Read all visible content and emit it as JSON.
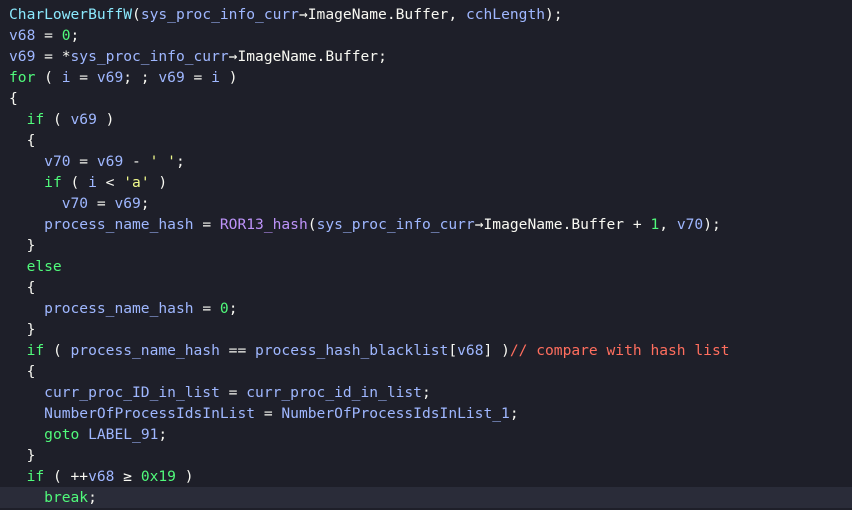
{
  "colors": {
    "background": "#1e1f29",
    "current_line": "#2a2c39",
    "identifier": "#8be9fd",
    "keyword": "#50fa7b",
    "number": "#50fa7b",
    "string": "#f1fa8c",
    "function_call": "#bd93f9",
    "comment": "#ff6e5e",
    "default_text": "#f8f8f2"
  },
  "code": {
    "highlighted_line": 23,
    "lines": [
      [
        [
          "fn",
          "CharLowerBuffW"
        ],
        [
          "pun",
          "("
        ],
        [
          "var",
          "sys_proc_info_curr"
        ],
        [
          "op",
          "→"
        ],
        [
          "fld",
          "ImageName.Buffer"
        ],
        [
          "pun",
          ", "
        ],
        [
          "var",
          "cchLength"
        ],
        [
          "pun",
          ");"
        ]
      ],
      [
        [
          "var",
          "v68"
        ],
        [
          "op",
          " = "
        ],
        [
          "num",
          "0"
        ],
        [
          "pun",
          ";"
        ]
      ],
      [
        [
          "var",
          "v69"
        ],
        [
          "op",
          " = "
        ],
        [
          "op",
          "*"
        ],
        [
          "var",
          "sys_proc_info_curr"
        ],
        [
          "op",
          "→"
        ],
        [
          "fld",
          "ImageName.Buffer"
        ],
        [
          "pun",
          ";"
        ]
      ],
      [
        [
          "kw",
          "for"
        ],
        [
          "pun",
          " ( "
        ],
        [
          "var",
          "i"
        ],
        [
          "op",
          " = "
        ],
        [
          "var",
          "v69"
        ],
        [
          "pun",
          "; ; "
        ],
        [
          "var",
          "v69"
        ],
        [
          "op",
          " = "
        ],
        [
          "var",
          "i"
        ],
        [
          "pun",
          " )"
        ]
      ],
      [
        [
          "pun",
          "{"
        ]
      ],
      [
        [
          "pun",
          "  "
        ],
        [
          "kw",
          "if"
        ],
        [
          "pun",
          " ( "
        ],
        [
          "var",
          "v69"
        ],
        [
          "pun",
          " )"
        ]
      ],
      [
        [
          "pun",
          "  {"
        ]
      ],
      [
        [
          "pun",
          "    "
        ],
        [
          "var",
          "v70"
        ],
        [
          "op",
          " = "
        ],
        [
          "var",
          "v69"
        ],
        [
          "op",
          " - "
        ],
        [
          "str",
          "' '"
        ],
        [
          "pun",
          ";"
        ]
      ],
      [
        [
          "pun",
          "    "
        ],
        [
          "kw",
          "if"
        ],
        [
          "pun",
          " ( "
        ],
        [
          "var",
          "i"
        ],
        [
          "op",
          " < "
        ],
        [
          "str",
          "'a'"
        ],
        [
          "pun",
          " )"
        ]
      ],
      [
        [
          "pun",
          "      "
        ],
        [
          "var",
          "v70"
        ],
        [
          "op",
          " = "
        ],
        [
          "var",
          "v69"
        ],
        [
          "pun",
          ";"
        ]
      ],
      [
        [
          "pun",
          "    "
        ],
        [
          "var",
          "process_name_hash"
        ],
        [
          "op",
          " = "
        ],
        [
          "call",
          "ROR13_hash"
        ],
        [
          "pun",
          "("
        ],
        [
          "var",
          "sys_proc_info_curr"
        ],
        [
          "op",
          "→"
        ],
        [
          "fld",
          "ImageName.Buffer"
        ],
        [
          "op",
          " + "
        ],
        [
          "num",
          "1"
        ],
        [
          "pun",
          ", "
        ],
        [
          "var",
          "v70"
        ],
        [
          "pun",
          ");"
        ]
      ],
      [
        [
          "pun",
          "  }"
        ]
      ],
      [
        [
          "pun",
          "  "
        ],
        [
          "kw",
          "else"
        ]
      ],
      [
        [
          "pun",
          "  {"
        ]
      ],
      [
        [
          "pun",
          "    "
        ],
        [
          "var",
          "process_name_hash"
        ],
        [
          "op",
          " = "
        ],
        [
          "num",
          "0"
        ],
        [
          "pun",
          ";"
        ]
      ],
      [
        [
          "pun",
          "  }"
        ]
      ],
      [
        [
          "pun",
          "  "
        ],
        [
          "kw",
          "if"
        ],
        [
          "pun",
          " ( "
        ],
        [
          "var",
          "process_name_hash"
        ],
        [
          "op",
          " == "
        ],
        [
          "var",
          "process_hash_blacklist"
        ],
        [
          "pun",
          "["
        ],
        [
          "var",
          "v68"
        ],
        [
          "pun",
          "] )"
        ],
        [
          "com",
          "// compare with hash list"
        ]
      ],
      [
        [
          "pun",
          "  {"
        ]
      ],
      [
        [
          "pun",
          "    "
        ],
        [
          "var",
          "curr_proc_ID_in_list"
        ],
        [
          "op",
          " = "
        ],
        [
          "var",
          "curr_proc_id_in_list"
        ],
        [
          "pun",
          ";"
        ]
      ],
      [
        [
          "pun",
          "    "
        ],
        [
          "var",
          "NumberOfProcessIdsInList"
        ],
        [
          "op",
          " = "
        ],
        [
          "var",
          "NumberOfProcessIdsInList_1"
        ],
        [
          "pun",
          ";"
        ]
      ],
      [
        [
          "pun",
          "    "
        ],
        [
          "kw",
          "goto"
        ],
        [
          "pun",
          " "
        ],
        [
          "var",
          "LABEL_91"
        ],
        [
          "pun",
          ";"
        ]
      ],
      [
        [
          "pun",
          "  }"
        ]
      ],
      [
        [
          "pun",
          "  "
        ],
        [
          "kw",
          "if"
        ],
        [
          "pun",
          " ( "
        ],
        [
          "op",
          "++"
        ],
        [
          "var",
          "v68"
        ],
        [
          "op",
          " ≥ "
        ],
        [
          "num",
          "0x19"
        ],
        [
          "pun",
          " )"
        ]
      ],
      [
        [
          "pun",
          "    "
        ],
        [
          "kw",
          "break"
        ],
        [
          "pun",
          ";"
        ]
      ]
    ]
  }
}
